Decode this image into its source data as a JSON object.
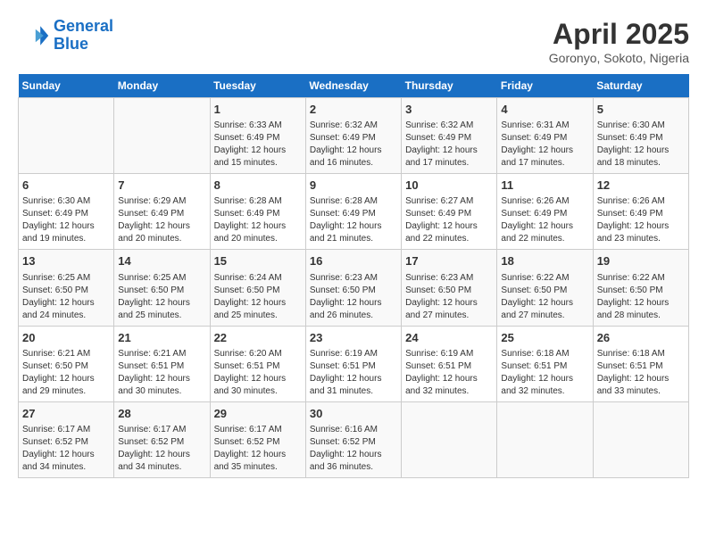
{
  "header": {
    "logo_line1": "General",
    "logo_line2": "Blue",
    "month": "April 2025",
    "location": "Goronyo, Sokoto, Nigeria"
  },
  "weekdays": [
    "Sunday",
    "Monday",
    "Tuesday",
    "Wednesday",
    "Thursday",
    "Friday",
    "Saturday"
  ],
  "weeks": [
    [
      {
        "day": "",
        "sunrise": "",
        "sunset": "",
        "daylight": ""
      },
      {
        "day": "",
        "sunrise": "",
        "sunset": "",
        "daylight": ""
      },
      {
        "day": "1",
        "sunrise": "Sunrise: 6:33 AM",
        "sunset": "Sunset: 6:49 PM",
        "daylight": "Daylight: 12 hours and 15 minutes."
      },
      {
        "day": "2",
        "sunrise": "Sunrise: 6:32 AM",
        "sunset": "Sunset: 6:49 PM",
        "daylight": "Daylight: 12 hours and 16 minutes."
      },
      {
        "day": "3",
        "sunrise": "Sunrise: 6:32 AM",
        "sunset": "Sunset: 6:49 PM",
        "daylight": "Daylight: 12 hours and 17 minutes."
      },
      {
        "day": "4",
        "sunrise": "Sunrise: 6:31 AM",
        "sunset": "Sunset: 6:49 PM",
        "daylight": "Daylight: 12 hours and 17 minutes."
      },
      {
        "day": "5",
        "sunrise": "Sunrise: 6:30 AM",
        "sunset": "Sunset: 6:49 PM",
        "daylight": "Daylight: 12 hours and 18 minutes."
      }
    ],
    [
      {
        "day": "6",
        "sunrise": "Sunrise: 6:30 AM",
        "sunset": "Sunset: 6:49 PM",
        "daylight": "Daylight: 12 hours and 19 minutes."
      },
      {
        "day": "7",
        "sunrise": "Sunrise: 6:29 AM",
        "sunset": "Sunset: 6:49 PM",
        "daylight": "Daylight: 12 hours and 20 minutes."
      },
      {
        "day": "8",
        "sunrise": "Sunrise: 6:28 AM",
        "sunset": "Sunset: 6:49 PM",
        "daylight": "Daylight: 12 hours and 20 minutes."
      },
      {
        "day": "9",
        "sunrise": "Sunrise: 6:28 AM",
        "sunset": "Sunset: 6:49 PM",
        "daylight": "Daylight: 12 hours and 21 minutes."
      },
      {
        "day": "10",
        "sunrise": "Sunrise: 6:27 AM",
        "sunset": "Sunset: 6:49 PM",
        "daylight": "Daylight: 12 hours and 22 minutes."
      },
      {
        "day": "11",
        "sunrise": "Sunrise: 6:26 AM",
        "sunset": "Sunset: 6:49 PM",
        "daylight": "Daylight: 12 hours and 22 minutes."
      },
      {
        "day": "12",
        "sunrise": "Sunrise: 6:26 AM",
        "sunset": "Sunset: 6:49 PM",
        "daylight": "Daylight: 12 hours and 23 minutes."
      }
    ],
    [
      {
        "day": "13",
        "sunrise": "Sunrise: 6:25 AM",
        "sunset": "Sunset: 6:50 PM",
        "daylight": "Daylight: 12 hours and 24 minutes."
      },
      {
        "day": "14",
        "sunrise": "Sunrise: 6:25 AM",
        "sunset": "Sunset: 6:50 PM",
        "daylight": "Daylight: 12 hours and 25 minutes."
      },
      {
        "day": "15",
        "sunrise": "Sunrise: 6:24 AM",
        "sunset": "Sunset: 6:50 PM",
        "daylight": "Daylight: 12 hours and 25 minutes."
      },
      {
        "day": "16",
        "sunrise": "Sunrise: 6:23 AM",
        "sunset": "Sunset: 6:50 PM",
        "daylight": "Daylight: 12 hours and 26 minutes."
      },
      {
        "day": "17",
        "sunrise": "Sunrise: 6:23 AM",
        "sunset": "Sunset: 6:50 PM",
        "daylight": "Daylight: 12 hours and 27 minutes."
      },
      {
        "day": "18",
        "sunrise": "Sunrise: 6:22 AM",
        "sunset": "Sunset: 6:50 PM",
        "daylight": "Daylight: 12 hours and 27 minutes."
      },
      {
        "day": "19",
        "sunrise": "Sunrise: 6:22 AM",
        "sunset": "Sunset: 6:50 PM",
        "daylight": "Daylight: 12 hours and 28 minutes."
      }
    ],
    [
      {
        "day": "20",
        "sunrise": "Sunrise: 6:21 AM",
        "sunset": "Sunset: 6:50 PM",
        "daylight": "Daylight: 12 hours and 29 minutes."
      },
      {
        "day": "21",
        "sunrise": "Sunrise: 6:21 AM",
        "sunset": "Sunset: 6:51 PM",
        "daylight": "Daylight: 12 hours and 30 minutes."
      },
      {
        "day": "22",
        "sunrise": "Sunrise: 6:20 AM",
        "sunset": "Sunset: 6:51 PM",
        "daylight": "Daylight: 12 hours and 30 minutes."
      },
      {
        "day": "23",
        "sunrise": "Sunrise: 6:19 AM",
        "sunset": "Sunset: 6:51 PM",
        "daylight": "Daylight: 12 hours and 31 minutes."
      },
      {
        "day": "24",
        "sunrise": "Sunrise: 6:19 AM",
        "sunset": "Sunset: 6:51 PM",
        "daylight": "Daylight: 12 hours and 32 minutes."
      },
      {
        "day": "25",
        "sunrise": "Sunrise: 6:18 AM",
        "sunset": "Sunset: 6:51 PM",
        "daylight": "Daylight: 12 hours and 32 minutes."
      },
      {
        "day": "26",
        "sunrise": "Sunrise: 6:18 AM",
        "sunset": "Sunset: 6:51 PM",
        "daylight": "Daylight: 12 hours and 33 minutes."
      }
    ],
    [
      {
        "day": "27",
        "sunrise": "Sunrise: 6:17 AM",
        "sunset": "Sunset: 6:52 PM",
        "daylight": "Daylight: 12 hours and 34 minutes."
      },
      {
        "day": "28",
        "sunrise": "Sunrise: 6:17 AM",
        "sunset": "Sunset: 6:52 PM",
        "daylight": "Daylight: 12 hours and 34 minutes."
      },
      {
        "day": "29",
        "sunrise": "Sunrise: 6:17 AM",
        "sunset": "Sunset: 6:52 PM",
        "daylight": "Daylight: 12 hours and 35 minutes."
      },
      {
        "day": "30",
        "sunrise": "Sunrise: 6:16 AM",
        "sunset": "Sunset: 6:52 PM",
        "daylight": "Daylight: 12 hours and 36 minutes."
      },
      {
        "day": "",
        "sunrise": "",
        "sunset": "",
        "daylight": ""
      },
      {
        "day": "",
        "sunrise": "",
        "sunset": "",
        "daylight": ""
      },
      {
        "day": "",
        "sunrise": "",
        "sunset": "",
        "daylight": ""
      }
    ]
  ]
}
